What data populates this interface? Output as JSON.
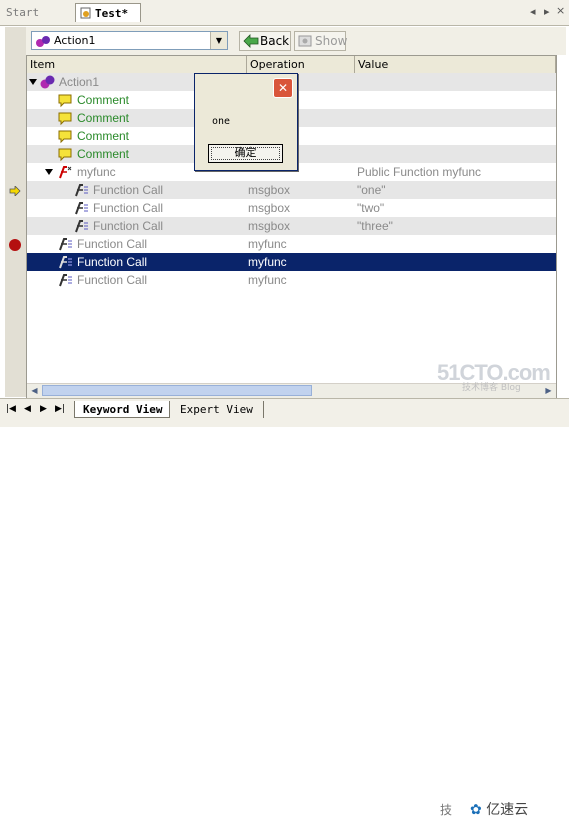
{
  "tabs": {
    "start": "Start Page",
    "active": "Test*"
  },
  "toolbar": {
    "action": "Action1",
    "back": "Back",
    "show": "Show"
  },
  "columns": {
    "item": "Item",
    "operation": "Operation",
    "value": "Value"
  },
  "rows": [
    {
      "item": "Action1",
      "op": "",
      "val": ""
    },
    {
      "item": "Comment",
      "op": "",
      "val": ""
    },
    {
      "item": "Comment",
      "op": "",
      "val": ""
    },
    {
      "item": "Comment",
      "op": "",
      "val": ""
    },
    {
      "item": "Comment",
      "op": "",
      "val": ""
    },
    {
      "item": "myfunc",
      "op": "",
      "val": "Public Function myfunc"
    },
    {
      "item": "Function Call",
      "op": "msgbox",
      "val": "\"one\""
    },
    {
      "item": "Function Call",
      "op": "msgbox",
      "val": "\"two\""
    },
    {
      "item": "Function Call",
      "op": "msgbox",
      "val": "\"three\""
    },
    {
      "item": "Function Call",
      "op": "myfunc",
      "val": ""
    },
    {
      "item": "Function Call",
      "op": "myfunc",
      "val": ""
    },
    {
      "item": "Function Call",
      "op": "myfunc",
      "val": ""
    }
  ],
  "dialog": {
    "message": "one",
    "ok": "确定"
  },
  "bottom_tabs": {
    "keyword": "Keyword View",
    "expert": "Expert View"
  },
  "watermark": {
    "brand": "51CTO.com",
    "sub": "技术博客  Blog",
    "logo_a": "技",
    "logo_b": "亿速云"
  }
}
